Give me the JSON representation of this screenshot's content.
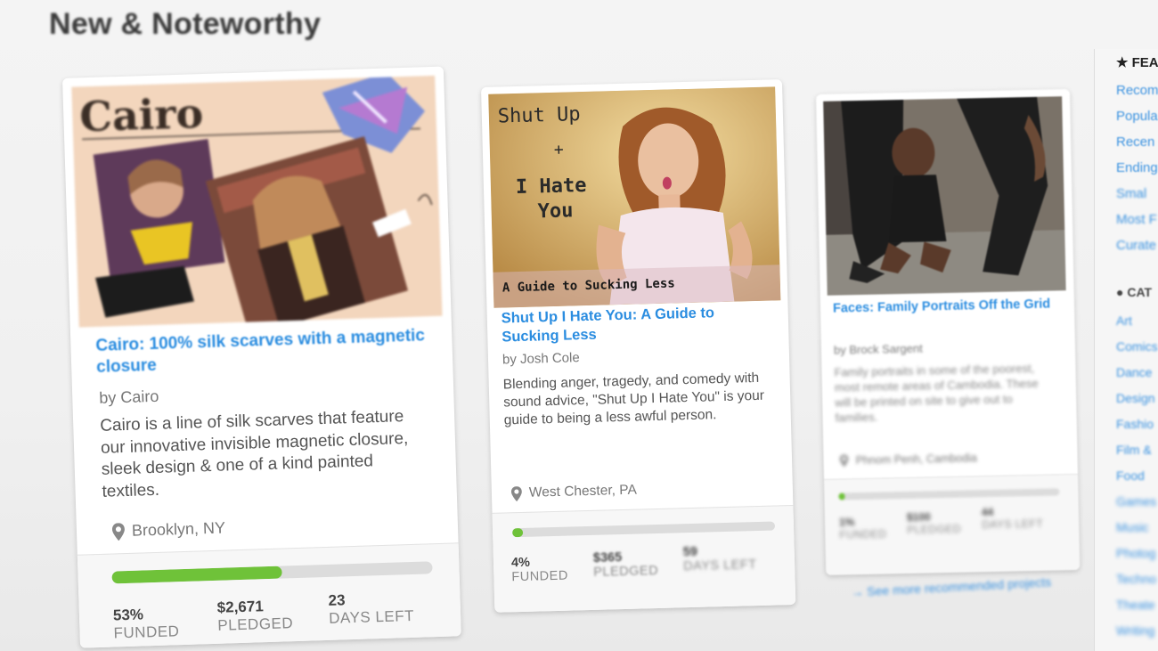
{
  "section_title": "New & Noteworthy",
  "projects": [
    {
      "image_text": "Cairo",
      "title": "Cairo: 100% silk scarves with a magnetic closure",
      "author": "by Cairo",
      "description": "Cairo is a line of silk scarves that feature our innovative invisible magnetic closure, sleek design & one of a kind painted textiles.",
      "location": "Brooklyn, NY",
      "funded_fraction": 0.53,
      "stats": [
        {
          "value": "53%",
          "label": "FUNDED"
        },
        {
          "value": "$2,671",
          "label": "PLEDGED"
        },
        {
          "value": "23",
          "label": "DAYS LEFT"
        }
      ]
    },
    {
      "image_text": "Shut Up + I Hate You A Guide to Sucking Less",
      "title": "Shut Up I Hate You: A Guide to Sucking Less",
      "author": "by Josh Cole",
      "description": "Blending anger, tragedy, and comedy with sound advice, \"Shut Up I Hate You\" is your guide to being a less awful person.",
      "location": "West Chester, PA",
      "funded_fraction": 0.04,
      "stats": [
        {
          "value": "4%",
          "label": "FUNDED"
        },
        {
          "value": "$365",
          "label": "PLEDGED"
        },
        {
          "value": "59",
          "label": "DAYS LEFT"
        }
      ]
    },
    {
      "title": "Faces: Family Portraits Off the Grid",
      "author": "by Brock Sargent",
      "description": "Family portraits in some of the poorest, most remote areas of Cambodia. These will be printed on site to give out to families.",
      "location": "Phnom Penh, Cambodia",
      "funded_fraction": 0.03,
      "stats": [
        {
          "value": "1%",
          "label": "FUNDED"
        },
        {
          "value": "$100",
          "label": "PLEDGED"
        },
        {
          "value": "44",
          "label": "DAYS LEFT"
        }
      ]
    }
  ],
  "see_more": "→ See more recommended projects",
  "sidebar": {
    "featured_heading": "★ FEA",
    "featured_links": [
      "Recom",
      "Popula",
      "Recen",
      "Ending",
      "Smal",
      "Most F",
      "Curate"
    ],
    "categories_heading": "CAT",
    "categories": [
      "Art",
      "Comics",
      "Dance",
      "Design",
      "Fashio",
      "Film &",
      "Food",
      "Games",
      "Music",
      "Photog",
      "Techno",
      "Theate",
      "Writing"
    ]
  },
  "colors": {
    "link": "#2b8de0",
    "progress": "#6fc239",
    "track": "#dcdcdc"
  }
}
